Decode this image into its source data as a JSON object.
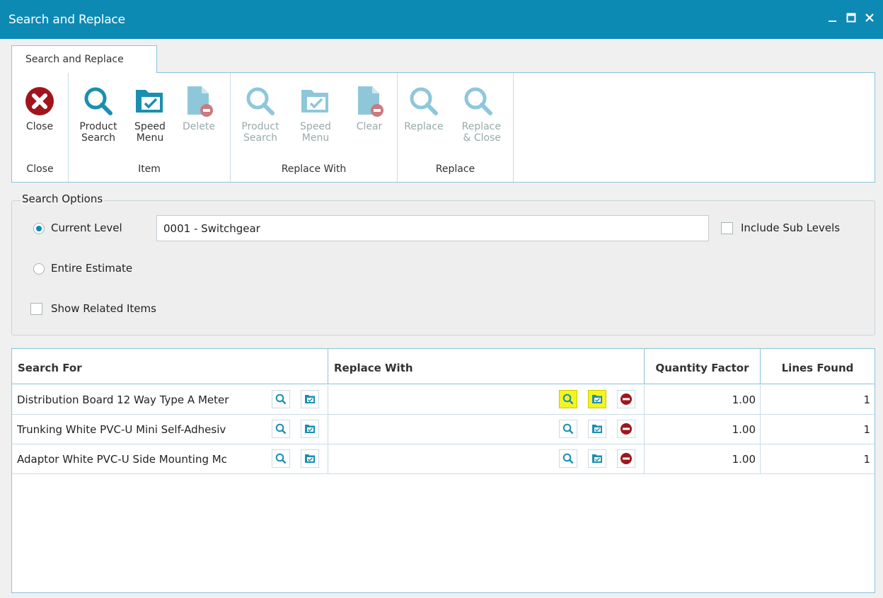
{
  "window": {
    "title": "Search and Replace",
    "controls": [
      "minimize",
      "maximize",
      "close"
    ]
  },
  "ribbon": {
    "tab": "Search and Replace",
    "groups": [
      {
        "label": "Close",
        "buttons": [
          {
            "label": "Close",
            "icon": "close-circle-icon",
            "enabled": true
          }
        ]
      },
      {
        "label": "Item",
        "buttons": [
          {
            "label": "Product\nSearch",
            "icon": "magnifier-icon",
            "enabled": true
          },
          {
            "label": "Speed\nMenu",
            "icon": "speed-menu-folder-icon",
            "enabled": true
          },
          {
            "label": "Delete",
            "icon": "delete-document-icon",
            "enabled": false
          }
        ]
      },
      {
        "label": "Replace With",
        "buttons": [
          {
            "label": "Product\nSearch",
            "icon": "magnifier-icon",
            "enabled": false
          },
          {
            "label": "Speed\nMenu",
            "icon": "speed-menu-folder-icon",
            "enabled": false
          },
          {
            "label": "Clear",
            "icon": "clear-document-icon",
            "enabled": false
          }
        ]
      },
      {
        "label": "Replace",
        "buttons": [
          {
            "label": "Replace",
            "icon": "magnifier-icon",
            "enabled": false
          },
          {
            "label": "Replace\n& Close",
            "icon": "magnifier-icon",
            "enabled": false
          }
        ]
      }
    ]
  },
  "search_options": {
    "legend": "Search Options",
    "current_level_label": "Current Level",
    "current_level_selected": true,
    "current_level_value": "0001 - Switchgear",
    "include_sub_levels_label": "Include Sub Levels",
    "include_sub_levels_checked": false,
    "entire_estimate_label": "Entire Estimate",
    "entire_estimate_selected": false,
    "show_related_label": "Show Related Items",
    "show_related_checked": false
  },
  "grid": {
    "columns": [
      "Search For",
      "Replace With",
      "Quantity Factor",
      "Lines Found"
    ],
    "rows": [
      {
        "search_for": "Distribution Board 12 Way Type A Meter",
        "replace_with": "",
        "quantity_factor": "1.00",
        "lines_found": "1",
        "highlighted": true
      },
      {
        "search_for": "Trunking White PVC-U Mini Self-Adhesiv",
        "replace_with": "",
        "quantity_factor": "1.00",
        "lines_found": "1",
        "highlighted": false
      },
      {
        "search_for": "Adaptor White PVC-U Side Mounting Mc",
        "replace_with": "",
        "quantity_factor": "1.00",
        "lines_found": "1",
        "highlighted": false
      }
    ]
  },
  "colors": {
    "accent": "#0c8ab4",
    "icon_blue": "#1a8fb0",
    "icon_disabled": "#8fc7da",
    "close_red": "#a0151c",
    "highlight": "#f5f51e"
  }
}
